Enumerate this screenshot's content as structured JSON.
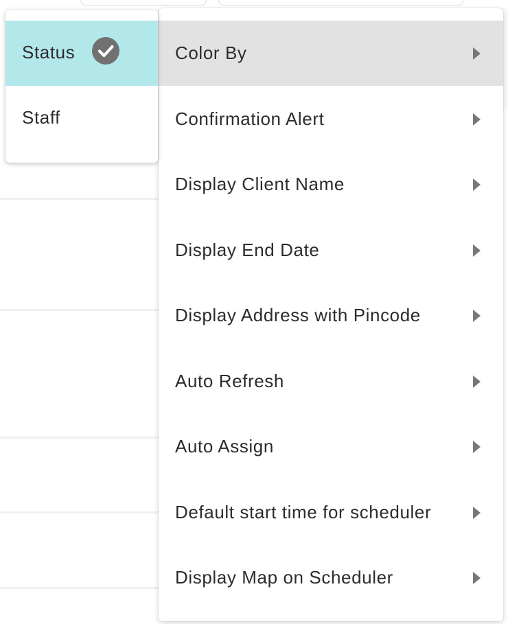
{
  "main_menu": {
    "items": [
      {
        "label": "Color By"
      },
      {
        "label": "Confirmation Alert"
      },
      {
        "label": "Display Client Name"
      },
      {
        "label": "Display End Date"
      },
      {
        "label": "Display Address with Pincode"
      },
      {
        "label": "Auto Refresh"
      },
      {
        "label": "Auto Assign"
      },
      {
        "label": "Default start time for scheduler"
      },
      {
        "label": "Display Map on Scheduler"
      }
    ],
    "active_item": "Color By",
    "icons": {
      "submenu_indicator": "chevron-right-icon"
    }
  },
  "sub_menu": {
    "parent": "Color By",
    "items": [
      {
        "label": "Status",
        "selected": true
      },
      {
        "label": "Staff",
        "selected": false
      }
    ],
    "icons": {
      "selected_indicator": "check-circle-icon"
    }
  },
  "colors": {
    "selected_bg": "#b3e8eb",
    "active_bg": "#e2e2e2",
    "icon": "#717171"
  }
}
